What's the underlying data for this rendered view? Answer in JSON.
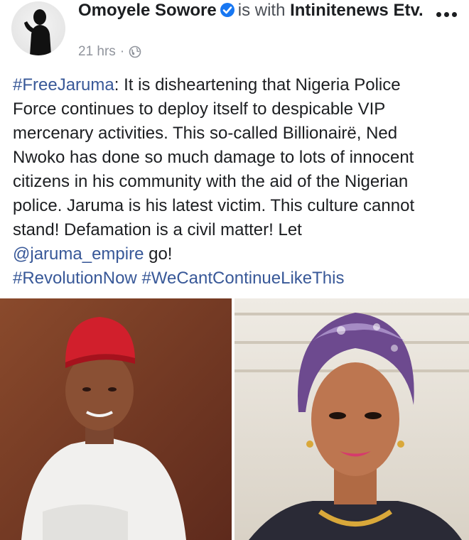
{
  "post": {
    "author": "Omoyele Sowore",
    "with_text": "is with",
    "tagged_page": "Intinitenews Etv.",
    "timestamp": "21 hrs",
    "separator": "·",
    "privacy_icon": "globe-icon",
    "more_icon": "more-options-icon",
    "verified_icon": "verified-badge-icon",
    "body_lines": [
      [
        {
          "t": "#FreeJaruma",
          "type": "hashtag"
        },
        {
          "t": ": It is disheartening that Nigeria Police",
          "type": "text"
        }
      ],
      [
        {
          "t": "Force continues to deploy itself to despicable VIP",
          "type": "text"
        }
      ],
      [
        {
          "t": "mercenary activities. This so-called Billionairë, Ned",
          "type": "text"
        }
      ],
      [
        {
          "t": "Nwoko has done so much damage to lots of innocent",
          "type": "text"
        }
      ],
      [
        {
          "t": "citizens in his community with the aid of the Nigerian",
          "type": "text"
        }
      ],
      [
        {
          "t": "police. Jaruma is his latest victim. This culture cannot",
          "type": "text"
        }
      ],
      [
        {
          "t": "stand! Defamation is a civil matter! Let",
          "type": "text"
        }
      ],
      [
        {
          "t": "@jaruma_empire",
          "type": "mention"
        },
        {
          "t": " go!",
          "type": "text"
        }
      ],
      [
        {
          "t": "#RevolutionNow",
          "type": "hashtag"
        },
        {
          "t": " ",
          "type": "text"
        },
        {
          "t": "#WeCantContinueLikeThis",
          "type": "hashtag"
        }
      ]
    ]
  },
  "colors": {
    "link": "#385898",
    "text": "#1c1e21",
    "meta": "#90949c",
    "verified": "#1877f2"
  },
  "photos": [
    {
      "subject": "man-in-red-cap-photo"
    },
    {
      "subject": "woman-in-purple-headwrap-photo"
    }
  ]
}
